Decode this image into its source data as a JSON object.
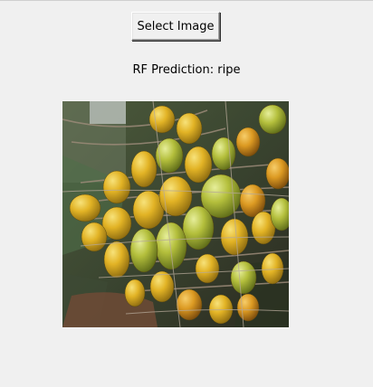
{
  "controls": {
    "select_button_label": "Select Image"
  },
  "result": {
    "prediction_text": "RF Prediction: ripe"
  },
  "image": {
    "subject": "cluster of ripening yellow-green palm fruits"
  },
  "colors": {
    "window_background": "#f0f0f0",
    "fruit_ripe": "#e8b020",
    "fruit_unripe": "#b5c23a"
  }
}
